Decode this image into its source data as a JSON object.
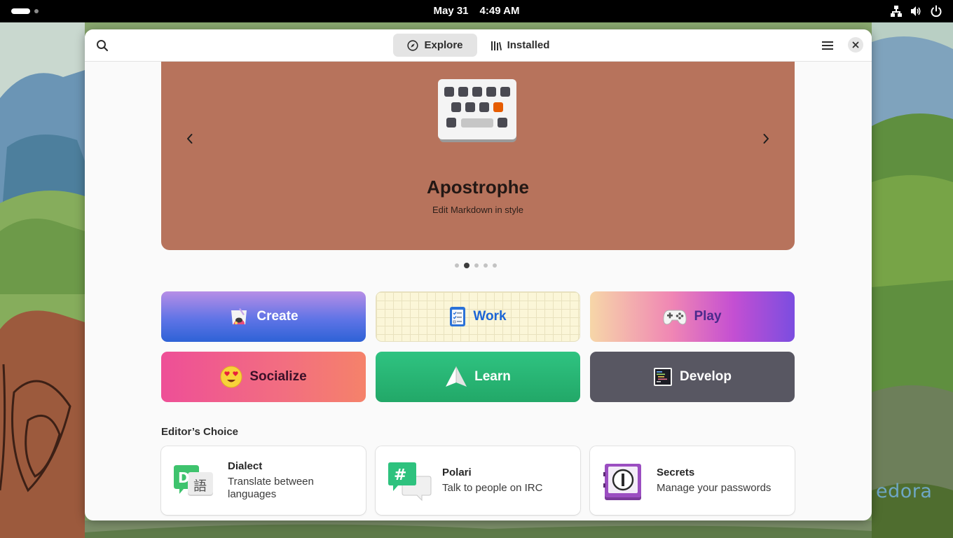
{
  "topbar": {
    "date": "May 31",
    "time": "4:49 AM",
    "tray_icons": [
      "network-wired-icon",
      "volume-icon",
      "power-icon"
    ]
  },
  "wallpaper": {
    "watermark": "edora"
  },
  "window": {
    "tabs": [
      {
        "label": "Explore",
        "icon": "compass-icon",
        "active": true
      },
      {
        "label": "Installed",
        "icon": "library-icon",
        "active": false
      }
    ],
    "buttons": {
      "search": "search-icon",
      "menu": "hamburger-menu-icon",
      "close": "close-icon"
    }
  },
  "carousel": {
    "title": "Apostrophe",
    "subtitle": "Edit Markdown in style",
    "background": "#b7735c",
    "page_count": 5,
    "active_page": 2
  },
  "categories": [
    {
      "label": "Create",
      "icon": "paint-palette-icon"
    },
    {
      "label": "Work",
      "icon": "checklist-icon"
    },
    {
      "label": "Play",
      "icon": "gamepad-icon"
    },
    {
      "label": "Socialize",
      "icon": "heart-eyes-emoji-icon"
    },
    {
      "label": "Learn",
      "icon": "paper-plane-icon"
    },
    {
      "label": "Develop",
      "icon": "terminal-icon"
    }
  ],
  "editors_choice": {
    "title": "Editor’s Choice",
    "apps": [
      {
        "name": "Dialect",
        "description": "Translate between languages",
        "icon": "dialect-app-icon"
      },
      {
        "name": "Polari",
        "description": "Talk to people on IRC",
        "icon": "polari-app-icon"
      },
      {
        "name": "Secrets",
        "description": "Manage your passwords",
        "icon": "secrets-app-icon"
      }
    ]
  }
}
